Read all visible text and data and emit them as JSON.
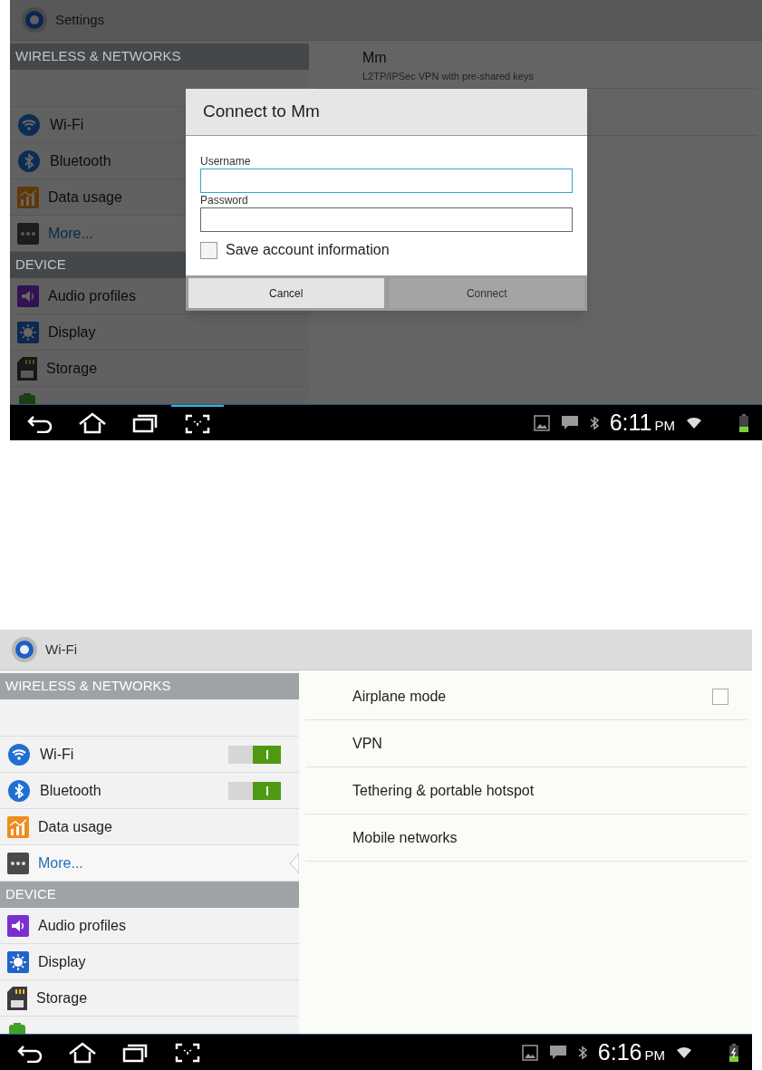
{
  "screens": [
    {
      "title": "Settings",
      "dimmed": true,
      "sidebar": {
        "sections": [
          {
            "header": "WIRELESS & NETWORKS",
            "items": [
              {
                "kind": "wifi",
                "label": "Wi-Fi",
                "selected": false
              },
              {
                "kind": "bluetooth",
                "label": "Bluetooth",
                "selected": false
              },
              {
                "kind": "data",
                "label": "Data usage",
                "selected": false
              },
              {
                "kind": "more",
                "label": "More...",
                "selected": true
              }
            ]
          },
          {
            "header": "DEVICE",
            "items": [
              {
                "kind": "audio",
                "label": "Audio profiles",
                "selected": false
              },
              {
                "kind": "display",
                "label": "Display",
                "selected": false
              },
              {
                "kind": "storage",
                "label": "Storage",
                "selected": false
              },
              {
                "kind": "battery"
              }
            ]
          }
        ]
      },
      "content": [
        {
          "kind": "vpn",
          "title": "Mm",
          "subtitle": "L2TP/IPSec VPN with pre-shared keys"
        },
        {
          "kind": "empty"
        }
      ],
      "dialog": {
        "title": "Connect to Mm",
        "fields": [
          {
            "label": "Username",
            "focused": true
          },
          {
            "label": "Password",
            "focused": false
          }
        ],
        "checkbox": {
          "label": "Save account information",
          "checked": false
        },
        "buttons": [
          {
            "label": "Cancel",
            "disabled": false
          },
          {
            "label": "Connect",
            "disabled": true
          }
        ]
      },
      "nav": [
        {
          "kind": "back",
          "selected": false
        },
        {
          "kind": "home",
          "selected": false
        },
        {
          "kind": "recent",
          "selected": false
        },
        {
          "kind": "screenshot",
          "selected": true
        }
      ],
      "status_bar": {
        "time": "6:11",
        "ampm": "PM",
        "charging": false
      }
    },
    {
      "title": "Wi-Fi",
      "dimmed": false,
      "sidebar": {
        "sections": [
          {
            "header": "WIRELESS & NETWORKS",
            "items": [
              {
                "kind": "wifi",
                "label": "Wi-Fi",
                "selected": false,
                "on": true
              },
              {
                "kind": "bluetooth",
                "label": "Bluetooth",
                "selected": false,
                "on": true
              },
              {
                "kind": "data",
                "label": "Data usage",
                "selected": false
              },
              {
                "kind": "more",
                "label": "More...",
                "selected": true
              }
            ]
          },
          {
            "header": "DEVICE",
            "items": [
              {
                "kind": "audio",
                "label": "Audio profiles",
                "selected": false
              },
              {
                "kind": "display",
                "label": "Display",
                "selected": false
              },
              {
                "kind": "storage",
                "label": "Storage",
                "selected": false
              },
              {
                "kind": "battery"
              }
            ]
          }
        ]
      },
      "content": [
        {
          "kind": "checkbox",
          "title": "Airplane mode",
          "checked": false
        },
        {
          "kind": "link",
          "title": "VPN"
        },
        {
          "kind": "link",
          "title": "Tethering & portable hotspot"
        },
        {
          "kind": "link",
          "title": "Mobile networks"
        }
      ],
      "nav": [
        {
          "kind": "back",
          "selected": false
        },
        {
          "kind": "home",
          "selected": false
        },
        {
          "kind": "recent",
          "selected": false
        },
        {
          "kind": "screenshot",
          "selected": false
        }
      ],
      "status_bar": {
        "time": "6:16",
        "ampm": "PM",
        "charging": true
      }
    }
  ]
}
